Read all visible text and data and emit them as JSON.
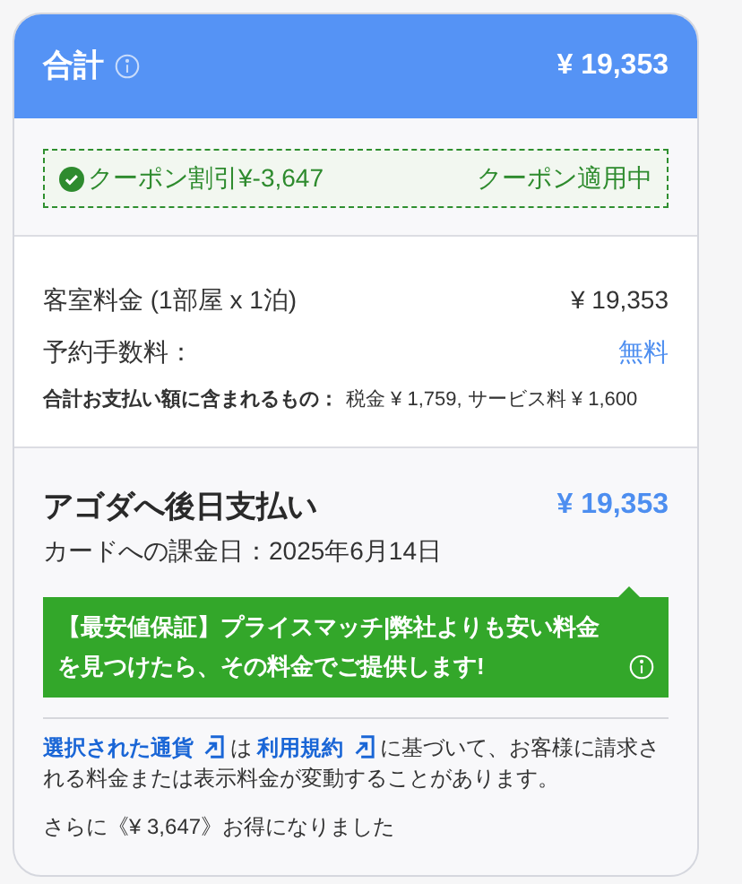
{
  "header": {
    "title": "合計",
    "total": "¥ 19,353"
  },
  "coupon": {
    "label": "クーポン割引¥-3,647",
    "status": "クーポン適用中",
    "applied": true
  },
  "breakdown": [
    {
      "label": "客室料金 (1部屋 x 1泊)",
      "value": "¥ 19,353",
      "kind": "plain"
    },
    {
      "label": "予約手数料：",
      "value": "無料",
      "kind": "free"
    }
  ],
  "included": {
    "label": "合計お支払い額に含まれるもの：",
    "value": "税金 ¥ 1,759, サービス料 ¥ 1,600"
  },
  "payment": {
    "title": "アゴダへ後日支払い",
    "amount": "¥ 19,353",
    "charge_date": "カードへの課金日：2025年6月14日"
  },
  "price_match": {
    "text": "【最安値保証】プライスマッチ|弊社よりも安い料金を見つけたら、その料金でご提供します!"
  },
  "terms": {
    "link_1": "選択された通貨",
    "joiner": "は",
    "link_2": "利用規約",
    "rest": "に基づいて、お客様に請求される料金または表示料金が変動することがあります。"
  },
  "savings": "さらに《¥ 3,647》お得になりました"
}
